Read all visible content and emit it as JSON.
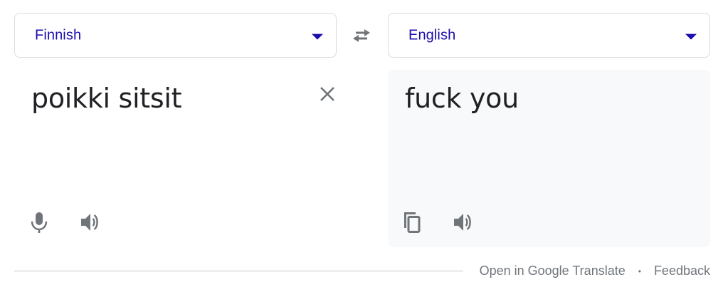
{
  "source_language": {
    "label": "Finnish",
    "icon": "chevron-down-icon"
  },
  "target_language": {
    "label": "English",
    "icon": "chevron-down-icon"
  },
  "swap": {
    "icon": "swap-horiz-icon"
  },
  "source": {
    "text": "poikki sitsit",
    "clear_icon": "close-icon",
    "mic_icon": "microphone-icon",
    "speak_icon": "volume-icon"
  },
  "target": {
    "text": "fuck you",
    "copy_icon": "copy-icon",
    "speak_icon": "volume-icon"
  },
  "footer": {
    "open_label": "Open in Google Translate",
    "separator": "•",
    "feedback_label": "Feedback"
  },
  "colors": {
    "language_text": "#1a0dab",
    "icon_gray": "#70757a",
    "text": "#202124",
    "target_bg": "#f8f9fa",
    "border": "#dadce0"
  }
}
